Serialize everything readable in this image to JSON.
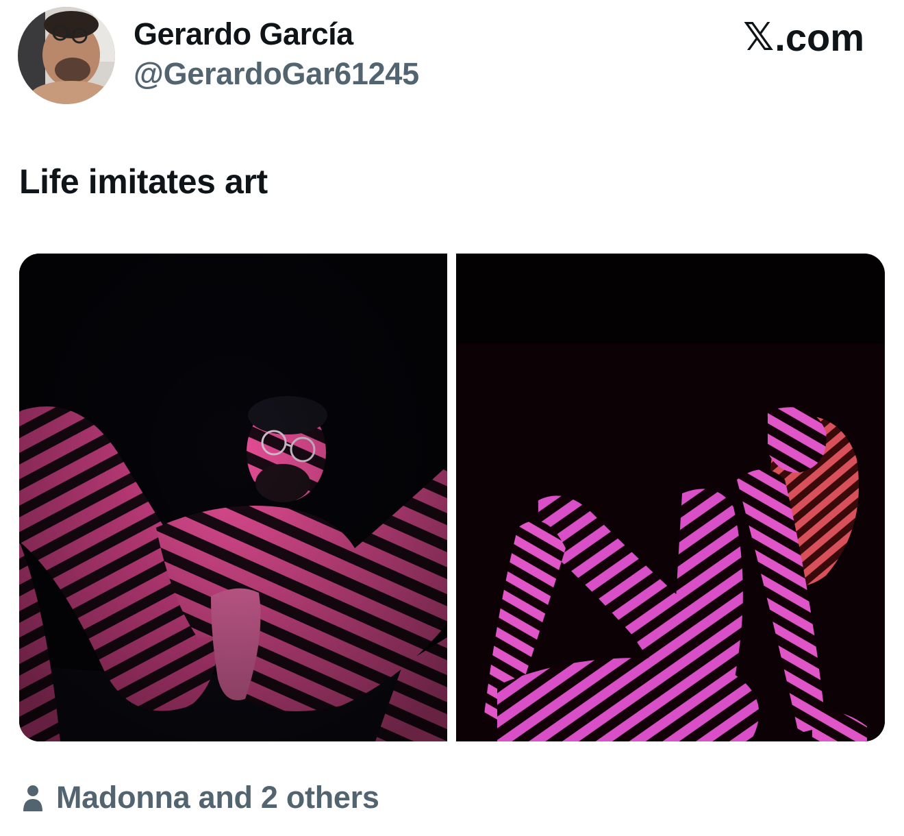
{
  "author": {
    "display_name": "Gerardo García",
    "handle": "@GerardoGar61245"
  },
  "brand": {
    "x_glyph": "𝕏",
    "domain": ".com"
  },
  "post": {
    "text": "Life imitates art"
  },
  "tagged": {
    "icon": "person-icon",
    "text": "Madonna and 2 others"
  },
  "colors": {
    "text_primary": "#0f1419",
    "text_secondary": "#536471",
    "stripe_pink": "#e0458f",
    "stripe_magenta": "#d84fc8"
  }
}
